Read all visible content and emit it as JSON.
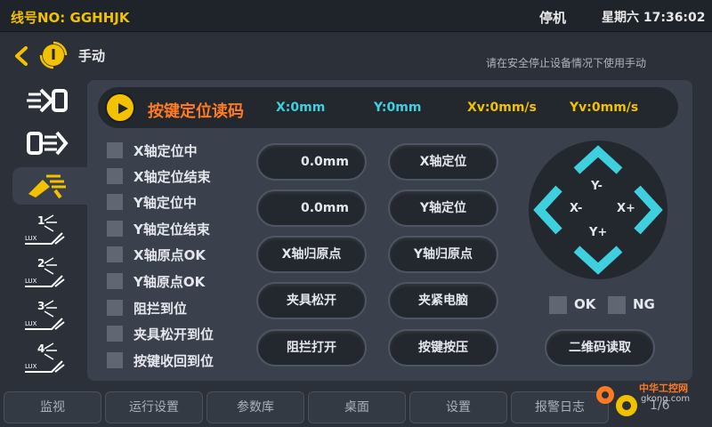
{
  "topbar": {
    "line_no": "线号NO:  GGHHJK",
    "state": "停机",
    "clock": "星期六 17:36:02"
  },
  "header": {
    "title": "手动",
    "hint": "请在安全停止设备情况下使用手动"
  },
  "sidebar": {
    "items": [
      {
        "icon": "axis-out-icon"
      },
      {
        "icon": "axis-in-icon"
      },
      {
        "icon": "gripper-icon",
        "active": true
      },
      {
        "icon": "station-1-icon",
        "label": "1",
        "sub": "LUX"
      },
      {
        "icon": "station-2-icon",
        "label": "2",
        "sub": "LUX"
      },
      {
        "icon": "station-3-icon",
        "label": "3",
        "sub": "LUX"
      },
      {
        "icon": "station-4-icon",
        "label": "4",
        "sub": "LUX"
      }
    ]
  },
  "readbar": {
    "title": "按键定位读码",
    "x": "X:0mm",
    "y": "Y:0mm",
    "xv": "Xv:0mm/s",
    "yv": "Yv:0mm/s"
  },
  "status_list": [
    "X轴定位中",
    "X轴定位结束",
    "Y轴定位中",
    "Y轴定位结束",
    "X轴原点OK",
    "Y轴原点OK",
    "阻拦到位",
    "夹具松开到位",
    "按键收回到位"
  ],
  "inputs": {
    "x_pos": "0.0mm",
    "y_pos": "0.0mm"
  },
  "buttons": {
    "x_locate": "X轴定位",
    "y_locate": "Y轴定位",
    "x_home": "X轴归原点",
    "y_home": "Y轴归原点",
    "fixture_release": "夹具松开",
    "clamp_pc": "夹紧电脑",
    "stopper_open": "阻拦打开",
    "key_press": "按键按压",
    "qr_read": "二维码读取"
  },
  "jog": {
    "y_minus": "Y-",
    "x_minus": "X-",
    "x_plus": "X+",
    "y_plus": "Y+"
  },
  "indicators": {
    "ok": "OK",
    "ng": "NG"
  },
  "nav": [
    "监视",
    "运行设置",
    "参数库",
    "桌面",
    "设置",
    "报警日志"
  ],
  "page_no": "1/6",
  "watermark": {
    "text": "中华工控网",
    "url": "gkong.com"
  },
  "colors": {
    "accent": "#f2c100",
    "orange": "#ff7a22",
    "cyan": "#3fd0e0",
    "panel": "#3b414c",
    "dark": "#23272e"
  }
}
